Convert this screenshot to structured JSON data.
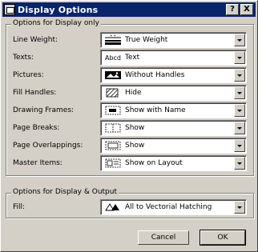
{
  "window": {
    "title": "Display Options",
    "help_label": "?",
    "close_label": "X"
  },
  "display_only": {
    "group_title": "Options for Display only",
    "rows": [
      {
        "label": "Line Weight:",
        "value": "True Weight",
        "icon": "line-weight-icon"
      },
      {
        "label": "Texts:",
        "value": "Text",
        "icon": "text-sample-icon",
        "icon_text": "Abcd"
      },
      {
        "label": "Pictures:",
        "value": "Without Handles",
        "icon": "picture-icon"
      },
      {
        "label": "Fill Handles:",
        "value": "Hide",
        "icon": "fill-hatch-icon"
      },
      {
        "label": "Drawing Frames:",
        "value": "Show with Name",
        "icon": "frame-icon"
      },
      {
        "label": "Page Breaks:",
        "value": "Show",
        "icon": "page-break-icon"
      },
      {
        "label": "Page Overlappings:",
        "value": "Show",
        "icon": "page-overlap-icon"
      },
      {
        "label": "Master Items:",
        "value": "Show on Layout",
        "icon": "master-items-icon"
      }
    ]
  },
  "display_output": {
    "group_title": "Options for Display & Output",
    "rows": [
      {
        "label": "Fill:",
        "value": "All to Vectorial Hatching",
        "icon": "vectorial-fill-icon"
      }
    ]
  },
  "buttons": {
    "cancel": "Cancel",
    "ok": "OK"
  }
}
